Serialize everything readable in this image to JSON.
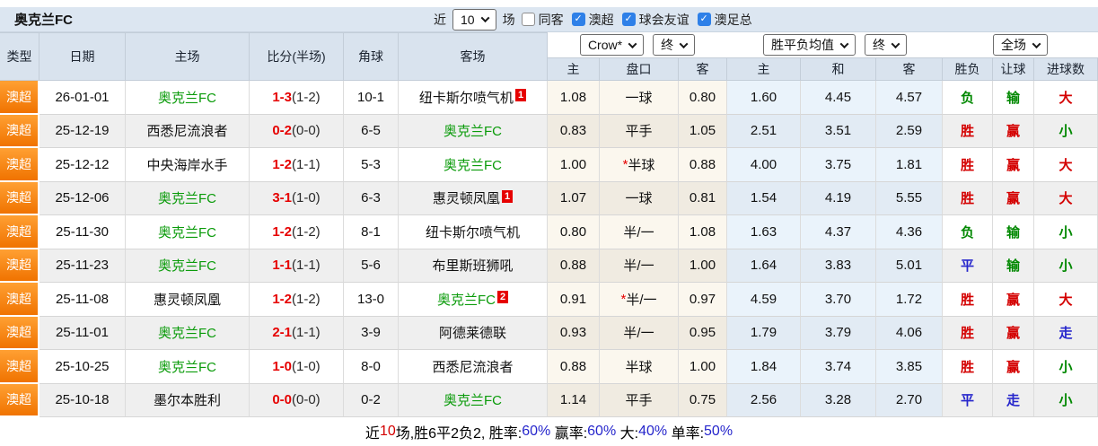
{
  "topbar": {
    "title": "奥克兰FC",
    "near_label": "近",
    "games_count": "10",
    "games_unit": "场",
    "filters": [
      {
        "label": "同客",
        "checked": false
      },
      {
        "label": "澳超",
        "checked": true
      },
      {
        "label": "球会友谊",
        "checked": true
      },
      {
        "label": "澳足总",
        "checked": true
      }
    ]
  },
  "controls": {
    "company_select": "Crow*",
    "company_time_select": "终",
    "avg_select": "胜平负均值",
    "avg_time_select": "终",
    "scope_select": "全场"
  },
  "table": {
    "columns": [
      "类型",
      "日期",
      "主场",
      "比分(半场)",
      "角球",
      "客场",
      "主",
      "盘口",
      "客",
      "主",
      "和",
      "客",
      "胜负",
      "让球",
      "进球数"
    ],
    "rows": [
      {
        "league": "澳超",
        "date": "26-01-01",
        "home": "奥克兰FC",
        "home_is_focus": true,
        "home_badge": "",
        "score": "1-3",
        "half": "(1-2)",
        "corners": "10-1",
        "away": "纽卡斯尔喷气机",
        "away_is_focus": false,
        "away_badge": "1",
        "odds_home": "1.08",
        "handicap": "一球",
        "handicap_star": false,
        "odds_away": "0.80",
        "avg_home": "1.60",
        "avg_draw": "4.45",
        "avg_away": "4.57",
        "result": {
          "text": "负",
          "color": "green"
        },
        "handicap_result": {
          "text": "输",
          "color": "green"
        },
        "goals_result": {
          "text": "大",
          "color": "red"
        }
      },
      {
        "league": "澳超",
        "date": "25-12-19",
        "home": "西悉尼流浪者",
        "home_is_focus": false,
        "home_badge": "",
        "score": "0-2",
        "half": "(0-0)",
        "corners": "6-5",
        "away": "奥克兰FC",
        "away_is_focus": true,
        "away_badge": "",
        "odds_home": "0.83",
        "handicap": "平手",
        "handicap_star": false,
        "odds_away": "1.05",
        "avg_home": "2.51",
        "avg_draw": "3.51",
        "avg_away": "2.59",
        "result": {
          "text": "胜",
          "color": "red"
        },
        "handicap_result": {
          "text": "赢",
          "color": "red"
        },
        "goals_result": {
          "text": "小",
          "color": "green"
        }
      },
      {
        "league": "澳超",
        "date": "25-12-12",
        "home": "中央海岸水手",
        "home_is_focus": false,
        "home_badge": "",
        "score": "1-2",
        "half": "(1-1)",
        "corners": "5-3",
        "away": "奥克兰FC",
        "away_is_focus": true,
        "away_badge": "",
        "odds_home": "1.00",
        "handicap": "半球",
        "handicap_star": true,
        "odds_away": "0.88",
        "avg_home": "4.00",
        "avg_draw": "3.75",
        "avg_away": "1.81",
        "result": {
          "text": "胜",
          "color": "red"
        },
        "handicap_result": {
          "text": "赢",
          "color": "red"
        },
        "goals_result": {
          "text": "大",
          "color": "red"
        }
      },
      {
        "league": "澳超",
        "date": "25-12-06",
        "home": "奥克兰FC",
        "home_is_focus": true,
        "home_badge": "",
        "score": "3-1",
        "half": "(1-0)",
        "corners": "6-3",
        "away": "惠灵顿凤凰",
        "away_is_focus": false,
        "away_badge": "1",
        "odds_home": "1.07",
        "handicap": "一球",
        "handicap_star": false,
        "odds_away": "0.81",
        "avg_home": "1.54",
        "avg_draw": "4.19",
        "avg_away": "5.55",
        "result": {
          "text": "胜",
          "color": "red"
        },
        "handicap_result": {
          "text": "赢",
          "color": "red"
        },
        "goals_result": {
          "text": "大",
          "color": "red"
        }
      },
      {
        "league": "澳超",
        "date": "25-11-30",
        "home": "奥克兰FC",
        "home_is_focus": true,
        "home_badge": "",
        "score": "1-2",
        "half": "(1-2)",
        "corners": "8-1",
        "away": "纽卡斯尔喷气机",
        "away_is_focus": false,
        "away_badge": "",
        "odds_home": "0.80",
        "handicap": "半/一",
        "handicap_star": false,
        "odds_away": "1.08",
        "avg_home": "1.63",
        "avg_draw": "4.37",
        "avg_away": "4.36",
        "result": {
          "text": "负",
          "color": "green"
        },
        "handicap_result": {
          "text": "输",
          "color": "green"
        },
        "goals_result": {
          "text": "小",
          "color": "green"
        }
      },
      {
        "league": "澳超",
        "date": "25-11-23",
        "home": "奥克兰FC",
        "home_is_focus": true,
        "home_badge": "",
        "score": "1-1",
        "half": "(1-1)",
        "corners": "5-6",
        "away": "布里斯班狮吼",
        "away_is_focus": false,
        "away_badge": "",
        "odds_home": "0.88",
        "handicap": "半/一",
        "handicap_star": false,
        "odds_away": "1.00",
        "avg_home": "1.64",
        "avg_draw": "3.83",
        "avg_away": "5.01",
        "result": {
          "text": "平",
          "color": "blue"
        },
        "handicap_result": {
          "text": "输",
          "color": "green"
        },
        "goals_result": {
          "text": "小",
          "color": "green"
        }
      },
      {
        "league": "澳超",
        "date": "25-11-08",
        "home": "惠灵顿凤凰",
        "home_is_focus": false,
        "home_badge": "",
        "score": "1-2",
        "half": "(1-2)",
        "corners": "13-0",
        "away": "奥克兰FC",
        "away_is_focus": true,
        "away_badge": "2",
        "odds_home": "0.91",
        "handicap": "半/一",
        "handicap_star": true,
        "odds_away": "0.97",
        "avg_home": "4.59",
        "avg_draw": "3.70",
        "avg_away": "1.72",
        "result": {
          "text": "胜",
          "color": "red"
        },
        "handicap_result": {
          "text": "赢",
          "color": "red"
        },
        "goals_result": {
          "text": "大",
          "color": "red"
        }
      },
      {
        "league": "澳超",
        "date": "25-11-01",
        "home": "奥克兰FC",
        "home_is_focus": true,
        "home_badge": "",
        "score": "2-1",
        "half": "(1-1)",
        "corners": "3-9",
        "away": "阿德莱德联",
        "away_is_focus": false,
        "away_badge": "",
        "odds_home": "0.93",
        "handicap": "半/一",
        "handicap_star": false,
        "odds_away": "0.95",
        "avg_home": "1.79",
        "avg_draw": "3.79",
        "avg_away": "4.06",
        "result": {
          "text": "胜",
          "color": "red"
        },
        "handicap_result": {
          "text": "赢",
          "color": "red"
        },
        "goals_result": {
          "text": "走",
          "color": "blue"
        }
      },
      {
        "league": "澳超",
        "date": "25-10-25",
        "home": "奥克兰FC",
        "home_is_focus": true,
        "home_badge": "",
        "score": "1-0",
        "half": "(1-0)",
        "corners": "8-0",
        "away": "西悉尼流浪者",
        "away_is_focus": false,
        "away_badge": "",
        "odds_home": "0.88",
        "handicap": "半球",
        "handicap_star": false,
        "odds_away": "1.00",
        "avg_home": "1.84",
        "avg_draw": "3.74",
        "avg_away": "3.85",
        "result": {
          "text": "胜",
          "color": "red"
        },
        "handicap_result": {
          "text": "赢",
          "color": "red"
        },
        "goals_result": {
          "text": "小",
          "color": "green"
        }
      },
      {
        "league": "澳超",
        "date": "25-10-18",
        "home": "墨尔本胜利",
        "home_is_focus": false,
        "home_badge": "",
        "score": "0-0",
        "half": "(0-0)",
        "corners": "0-2",
        "away": "奥克兰FC",
        "away_is_focus": true,
        "away_badge": "",
        "odds_home": "1.14",
        "handicap": "平手",
        "handicap_star": false,
        "odds_away": "0.75",
        "avg_home": "2.56",
        "avg_draw": "3.28",
        "avg_away": "2.70",
        "result": {
          "text": "平",
          "color": "blue"
        },
        "handicap_result": {
          "text": "走",
          "color": "blue"
        },
        "goals_result": {
          "text": "小",
          "color": "green"
        }
      }
    ]
  },
  "footer": {
    "segments": [
      {
        "text": "近",
        "color": "black"
      },
      {
        "text": "10",
        "color": "red"
      },
      {
        "text": "场,胜6平2负2, 胜率:",
        "color": "black"
      },
      {
        "text": "60%",
        "color": "blue"
      },
      {
        "text": " 赢率:",
        "color": "black"
      },
      {
        "text": "60%",
        "color": "blue"
      },
      {
        "text": " 大:",
        "color": "black"
      },
      {
        "text": "40%",
        "color": "blue"
      },
      {
        "text": " 单率:",
        "color": "black"
      },
      {
        "text": "50%",
        "color": "blue"
      }
    ]
  },
  "colors": {
    "red": "#d40000",
    "green": "#008800",
    "blue": "#2626cc",
    "black": "#000000",
    "focus_team_green": "#0a9b0a",
    "league_orange": "#f07300",
    "header_blue": "#d9e3ee",
    "checkbox_blue": "#2e80e8"
  }
}
